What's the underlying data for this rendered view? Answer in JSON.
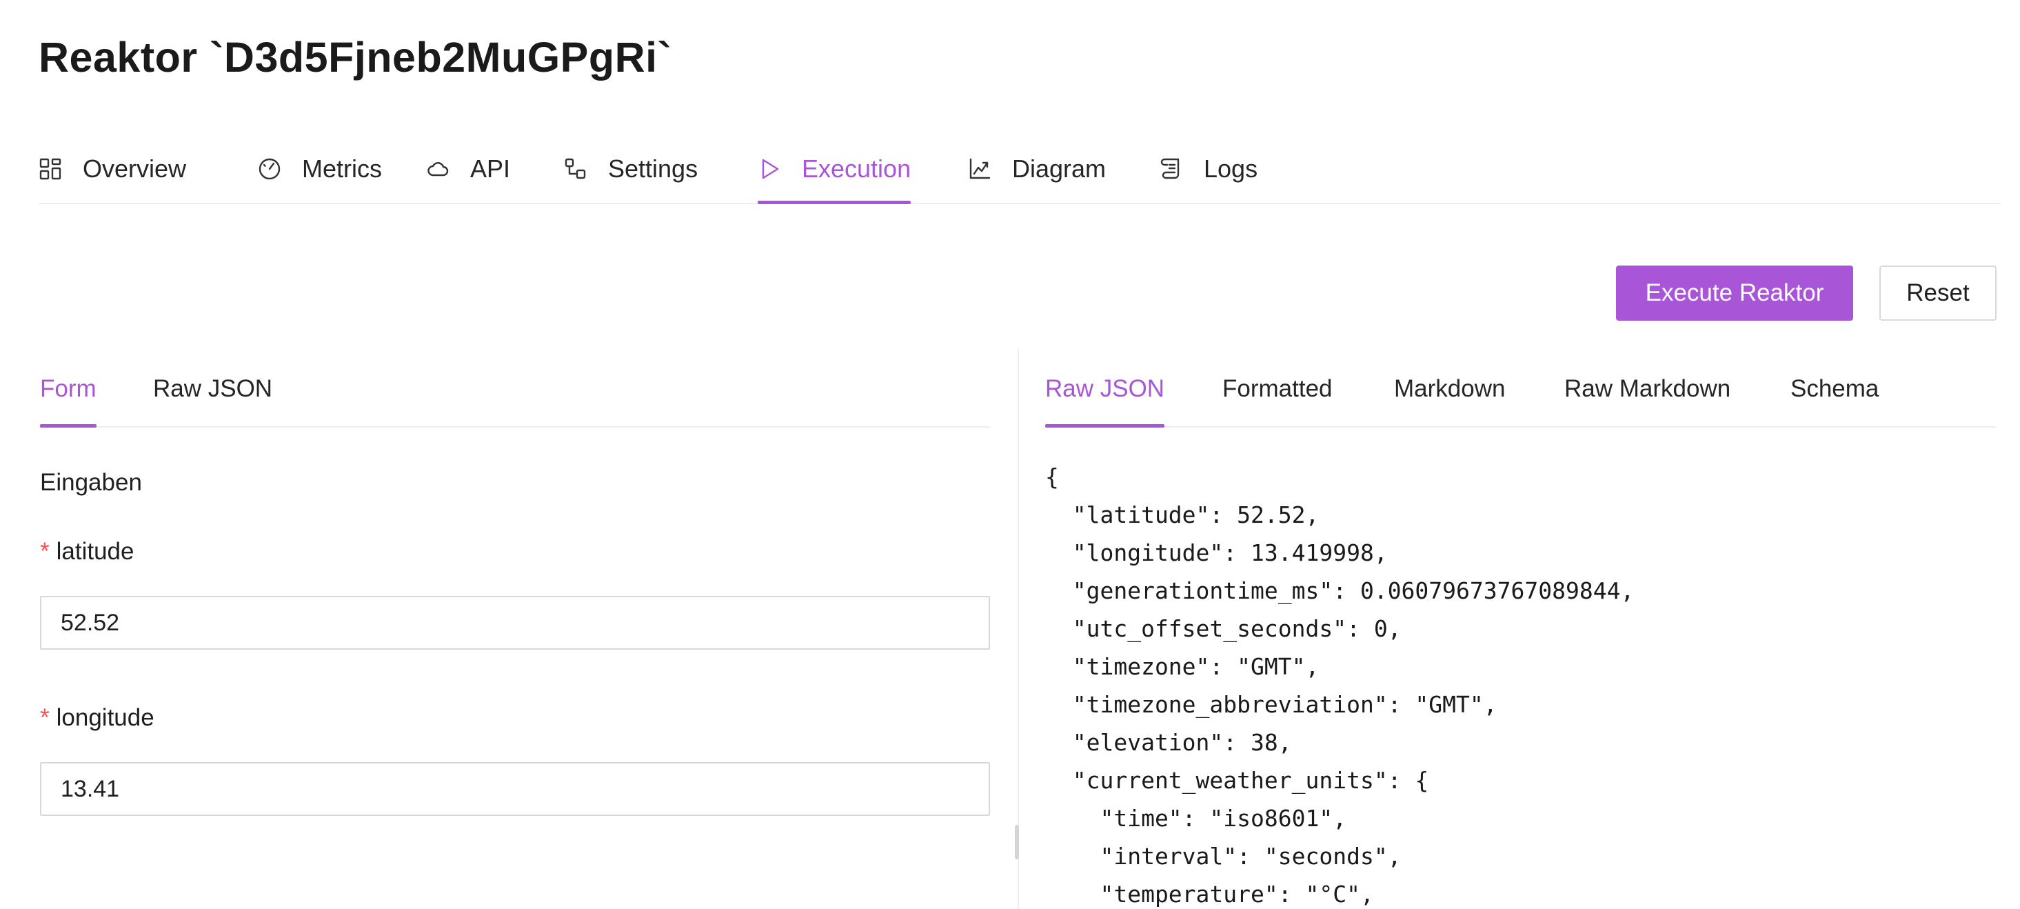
{
  "page": {
    "title": "Reaktor `D3d5Fjneb2MuGPgRi`"
  },
  "tabs": [
    {
      "label": "Overview",
      "icon": "grid-icon"
    },
    {
      "label": "Metrics",
      "icon": "gauge-icon"
    },
    {
      "label": "API",
      "icon": "cloud-icon"
    },
    {
      "label": "Settings",
      "icon": "nodes-icon"
    },
    {
      "label": "Execution",
      "icon": "play-icon",
      "active": true
    },
    {
      "label": "Diagram",
      "icon": "chart-icon"
    },
    {
      "label": "Logs",
      "icon": "scroll-icon"
    }
  ],
  "actions": {
    "execute_label": "Execute Reaktor",
    "reset_label": "Reset"
  },
  "input_panel": {
    "tabs": [
      {
        "label": "Form",
        "active": true
      },
      {
        "label": "Raw JSON"
      }
    ],
    "section_title": "Eingaben",
    "fields": [
      {
        "required_mark": "*",
        "label": "latitude",
        "value": "52.52"
      },
      {
        "required_mark": "*",
        "label": "longitude",
        "value": "13.41"
      }
    ]
  },
  "output_panel": {
    "tabs": [
      {
        "label": "Raw JSON",
        "active": true
      },
      {
        "label": "Formatted"
      },
      {
        "label": "Markdown"
      },
      {
        "label": "Raw Markdown"
      },
      {
        "label": "Schema"
      }
    ],
    "json_lines": [
      "{",
      "  \"latitude\": 52.52,",
      "  \"longitude\": 13.419998,",
      "  \"generationtime_ms\": 0.06079673767089844,",
      "  \"utc_offset_seconds\": 0,",
      "  \"timezone\": \"GMT\",",
      "  \"timezone_abbreviation\": \"GMT\",",
      "  \"elevation\": 38,",
      "  \"current_weather_units\": {",
      "    \"time\": \"iso8601\",",
      "    \"interval\": \"seconds\",",
      "    \"temperature\": \"°C\","
    ]
  },
  "colors": {
    "accent": "#a855d8",
    "required": "#ff4d4f",
    "border": "#d9d9d9"
  }
}
